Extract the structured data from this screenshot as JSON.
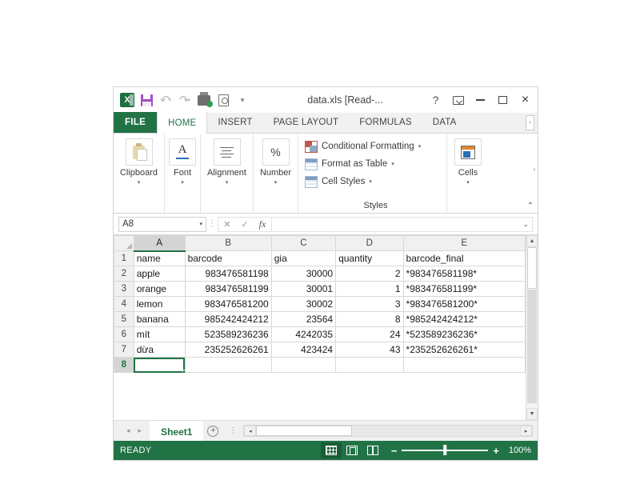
{
  "window": {
    "title": "data.xls  [Read-...",
    "quick_access": [
      {
        "name": "excel-logo",
        "label": "X"
      },
      {
        "name": "save",
        "label": "Save"
      },
      {
        "name": "undo",
        "label": "Undo"
      },
      {
        "name": "redo",
        "label": "Redo"
      },
      {
        "name": "quick-print",
        "label": "Quick Print"
      },
      {
        "name": "print-preview",
        "label": "Print Preview and Print"
      },
      {
        "name": "customize-qat",
        "label": "Customize Quick Access Toolbar"
      }
    ],
    "controls": {
      "help": "?",
      "ribbon_display": "Ribbon Display Options",
      "minimize": "Minimize",
      "maximize": "Maximize",
      "close": "×"
    }
  },
  "ribbon": {
    "file_tab": "FILE",
    "tabs": [
      {
        "label": "HOME",
        "active": true
      },
      {
        "label": "INSERT",
        "active": false
      },
      {
        "label": "PAGE LAYOUT",
        "active": false
      },
      {
        "label": "FORMULAS",
        "active": false
      },
      {
        "label": "DATA",
        "active": false
      }
    ],
    "overflow": "›",
    "groups": [
      {
        "label": "Clipboard",
        "caret": "▾"
      },
      {
        "label": "Font",
        "caret": "▾"
      },
      {
        "label": "Alignment",
        "caret": "▾"
      },
      {
        "label": "Number",
        "caret": "▾"
      },
      {
        "label": "Cells",
        "caret": "▾"
      }
    ],
    "styles": {
      "name": "Styles",
      "items": [
        {
          "label": "Conditional Formatting",
          "caret": "▾"
        },
        {
          "label": "Format as Table",
          "caret": "▾"
        },
        {
          "label": "Cell Styles",
          "caret": "▾"
        }
      ]
    },
    "collapse": "⌃",
    "group_overflow": "›"
  },
  "formula_bar": {
    "name_box": "A8",
    "name_box_caret": "▾",
    "cancel": "✕",
    "enter": "✓",
    "insert_function": "fx",
    "value": "",
    "expand_caret": "⌄"
  },
  "sheet": {
    "columns": [
      "A",
      "B",
      "C",
      "D",
      "E"
    ],
    "selected_column": "A",
    "selected_row": 8,
    "active_cell": "A8",
    "rows": [
      {
        "num": 1,
        "cells": [
          {
            "v": "name",
            "align": "left"
          },
          {
            "v": "barcode",
            "align": "left"
          },
          {
            "v": "gia",
            "align": "left"
          },
          {
            "v": "quantity",
            "align": "left"
          },
          {
            "v": "barcode_final",
            "align": "left"
          }
        ]
      },
      {
        "num": 2,
        "cells": [
          {
            "v": "apple",
            "align": "left"
          },
          {
            "v": "983476581198",
            "align": "right"
          },
          {
            "v": "30000",
            "align": "right"
          },
          {
            "v": "2",
            "align": "right"
          },
          {
            "v": "*983476581198*",
            "align": "left"
          }
        ]
      },
      {
        "num": 3,
        "cells": [
          {
            "v": "orange",
            "align": "left"
          },
          {
            "v": "983476581199",
            "align": "right"
          },
          {
            "v": "30001",
            "align": "right"
          },
          {
            "v": "1",
            "align": "right"
          },
          {
            "v": "*983476581199*",
            "align": "left"
          }
        ]
      },
      {
        "num": 4,
        "cells": [
          {
            "v": "lemon",
            "align": "left"
          },
          {
            "v": "983476581200",
            "align": "right"
          },
          {
            "v": "30002",
            "align": "right"
          },
          {
            "v": "3",
            "align": "right"
          },
          {
            "v": "*983476581200*",
            "align": "left"
          }
        ]
      },
      {
        "num": 5,
        "cells": [
          {
            "v": "banana",
            "align": "left"
          },
          {
            "v": "985242424212",
            "align": "right"
          },
          {
            "v": "23564",
            "align": "right"
          },
          {
            "v": "8",
            "align": "right"
          },
          {
            "v": "*985242424212*",
            "align": "left"
          }
        ]
      },
      {
        "num": 6,
        "cells": [
          {
            "v": "mít",
            "align": "left"
          },
          {
            "v": "523589236236",
            "align": "right"
          },
          {
            "v": "4242035",
            "align": "right"
          },
          {
            "v": "24",
            "align": "right"
          },
          {
            "v": "*523589236236*",
            "align": "left"
          }
        ]
      },
      {
        "num": 7,
        "cells": [
          {
            "v": "dừa",
            "align": "left"
          },
          {
            "v": "235252626261",
            "align": "right"
          },
          {
            "v": "423424",
            "align": "right"
          },
          {
            "v": "43",
            "align": "right"
          },
          {
            "v": "*235252626261*",
            "align": "left"
          }
        ]
      },
      {
        "num": 8,
        "cells": [
          {
            "v": "",
            "align": "left"
          },
          {
            "v": "",
            "align": "left"
          },
          {
            "v": "",
            "align": "left"
          },
          {
            "v": "",
            "align": "left"
          },
          {
            "v": "",
            "align": "left"
          }
        ]
      }
    ]
  },
  "sheet_tabs": {
    "prev": "◂",
    "next": "▸",
    "tabs": [
      {
        "label": "Sheet1",
        "active": true
      }
    ],
    "new_sheet": "+",
    "tab_menu": "⋮",
    "hscroll_left": "◂",
    "hscroll_right": "▸"
  },
  "status_bar": {
    "mode": "READY",
    "views": [
      {
        "name": "normal-view",
        "active": true
      },
      {
        "name": "page-layout-view",
        "active": false
      },
      {
        "name": "page-break-preview",
        "active": false
      }
    ],
    "zoom_out": "−",
    "zoom_in": "+",
    "zoom_level": "100%"
  },
  "colors": {
    "excel_green": "#217346",
    "file_tab": "#217346",
    "selection": "#217346",
    "save_icon": "#a54fc4"
  }
}
